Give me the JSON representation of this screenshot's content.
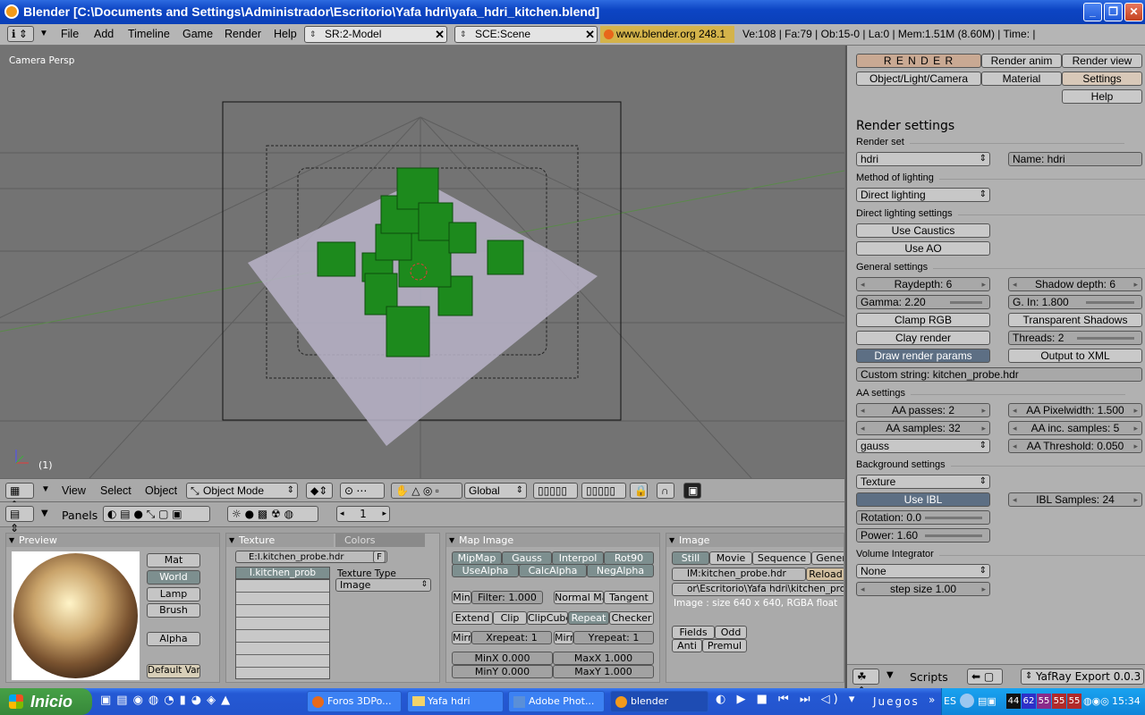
{
  "window": {
    "title": "Blender [C:\\Documents and Settings\\Administrador\\Escritorio\\Yafa hdri\\yafa_hdri_kitchen.blend]"
  },
  "topbar": {
    "menus": [
      "File",
      "Add",
      "Timeline",
      "Game",
      "Render",
      "Help"
    ],
    "screen": "SR:2-Model",
    "scene": "SCE:Scene",
    "site": "www.blender.org 248.1",
    "stats": "Ve:108 | Fa:79 | Ob:15-0 | La:0 | Mem:1.51M (8.60M) | Time: |"
  },
  "viewport": {
    "label": "Camera Persp",
    "frame": "(1)"
  },
  "vphead": {
    "menus": [
      "View",
      "Select",
      "Object"
    ],
    "mode": "Object Mode",
    "orientation": "Global"
  },
  "btnhead": {
    "panels": "Panels",
    "frame": "1"
  },
  "preview": {
    "title": "Preview",
    "buttons": [
      "Mat",
      "World",
      "Lamp",
      "Brush"
    ],
    "alpha": "Alpha",
    "defaults": "Default Vars"
  },
  "texture": {
    "tab1": "Texture",
    "tab2": "Colors",
    "file": "E:I.kitchen_probe.hdr",
    "flag": "F",
    "slot": "I.kitchen_prob",
    "type_label": "Texture Type",
    "type": "Image"
  },
  "mapimage": {
    "title": "Map Image",
    "row1": [
      "MipMap",
      "Gauss",
      "Interpol",
      "Rot90"
    ],
    "row2": [
      "UseAlpha",
      "CalcAlpha",
      "NegAlpha"
    ],
    "min": "Min",
    "filter": "Filter: 1.000",
    "normalmap": "Normal Ma",
    "tangent": "Tangent",
    "row3": [
      "Extend",
      "Clip",
      "ClipCube",
      "Repeat",
      "Checker"
    ],
    "mirr": "Mirr",
    "xrepeat": "Xrepeat: 1",
    "yrepeat": "Yrepeat: 1",
    "minx": "MinX 0.000",
    "maxx": "MaxX 1.000",
    "miny": "MinY 0.000",
    "maxy": "MaxY 1.000"
  },
  "image": {
    "title": "Image",
    "tabs": [
      "Still",
      "Movie",
      "Sequence",
      "Gener"
    ],
    "name": "IM:kitchen_probe.hdr",
    "reload": "Reload",
    "path": "or\\Escritorio\\Yafa hdri\\kitchen_probe.",
    "info": "Image : size 640 x 640, RGBA float",
    "fields": "Fields",
    "odd": "Odd",
    "anti": "Anti",
    "premul": "Premul"
  },
  "right": {
    "tabs": [
      "R E N D E R",
      "Render anim",
      "Render view",
      "Object/Light/Camera",
      "Material",
      "Settings",
      "Help"
    ],
    "heading": "Render settings",
    "render_set": "Render set",
    "set_value": "hdri",
    "name": "Name: hdri",
    "method_label": "Method of lighting",
    "method": "Direct lighting",
    "direct_label": "Direct lighting settings",
    "caustics": "Use Caustics",
    "ao": "Use AO",
    "general_label": "General settings",
    "raydepth": "Raydepth: 6",
    "shadowdepth": "Shadow depth: 6",
    "gamma": "Gamma: 2.20",
    "gin": "G. In: 1.800",
    "clamp": "Clamp RGB",
    "transp": "Transparent Shadows",
    "clay": "Clay render",
    "threads": "Threads: 2",
    "draw": "Draw render params",
    "xml": "Output to XML",
    "custom": "Custom string: kitchen_probe.hdr",
    "aa_label": "AA settings",
    "aapasses": "AA passes: 2",
    "aapixel": "AA Pixelwidth: 1.500",
    "aasamples": "AA samples: 32",
    "aainc": "AA inc. samples: 5",
    "filter": "gauss",
    "aathresh": "AA Threshold: 0.050",
    "bg_label": "Background settings",
    "bg": "Texture",
    "ibl": "Use IBL",
    "iblsamples": "IBL Samples: 24",
    "rotation": "Rotation: 0.0",
    "power": "Power: 1.60",
    "vol_label": "Volume Integrator",
    "vol": "None",
    "step": "step size 1.00",
    "scripts": "Scripts",
    "script_name": "YafRay Export 0.0.3"
  },
  "taskbar": {
    "start": "Inicio",
    "tasks": [
      "Foros 3DPo...",
      "Yafa hdri",
      "Adobe Phot...",
      "blender"
    ],
    "toolbar": "Juegos",
    "lang": "ES",
    "tray_nums": [
      "44",
      "62",
      "55",
      "55",
      "55"
    ],
    "time": "15:34"
  }
}
